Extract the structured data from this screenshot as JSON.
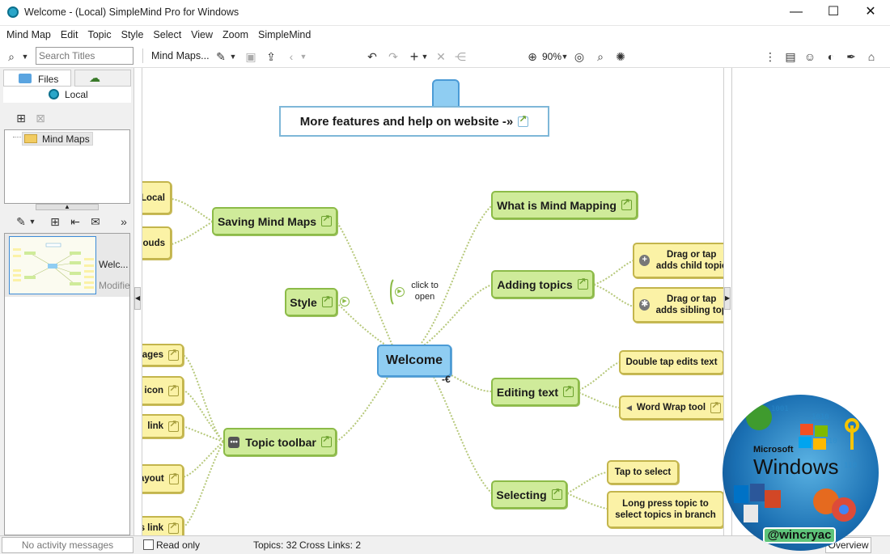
{
  "window": {
    "title": "Welcome - (Local) SimpleMind Pro for Windows",
    "minimize": "—",
    "maximize": "☐",
    "close": "✕"
  },
  "menu": [
    "Mind Map",
    "Edit",
    "Topic",
    "Style",
    "Select",
    "View",
    "Zoom",
    "SimpleMind"
  ],
  "search": {
    "placeholder": "Search Titles"
  },
  "toolbar": {
    "mindmaps_label": "Mind Maps...",
    "zoom": "90%"
  },
  "left": {
    "tab_files": "Files",
    "tab_local": "Local",
    "tree_item": "Mind Maps",
    "thumb_title": "Welc...",
    "thumb_sub": "Modifie"
  },
  "status": {
    "activity": "No activity messages",
    "readonly": "Read only",
    "topics": "Topics: 32",
    "crosslinks": "Cross Links: 2",
    "overview": "Overview"
  },
  "mindmap": {
    "features": "More features and help on website -»",
    "central": "Welcome",
    "click_to_open": "click to open",
    "nodes": {
      "saving": "Saving Mind Maps",
      "style": "Style",
      "topic_toolbar": "Topic toolbar",
      "what_is": "What is Mind Mapping",
      "adding": "Adding topics",
      "editing": "Editing text",
      "selecting": "Selecting"
    },
    "sub": {
      "local": "Local",
      "clouds": "louds",
      "pages": "ages",
      "icon": "l icon",
      "link": "link",
      "layout": "ayout",
      "s_link": "s link",
      "drag_child": "Drag or tap adds child topic",
      "drag_sibling": "Drag or tap adds sibling top",
      "double_tap": "Double tap edits text",
      "word_wrap": "Word Wrap tool",
      "tap_select": "Tap to select",
      "long_press": "Long press topic to select topics in branch"
    }
  },
  "watermark": {
    "brand": "Windows",
    "brand_small": "Microsoft",
    "handle": "@wincryac"
  },
  "colors": {
    "topic_fill": "#cfeb9a",
    "topic_border": "#8cbb48",
    "leaf_fill": "#fbf2a6",
    "central_fill": "#8fcdf2"
  }
}
